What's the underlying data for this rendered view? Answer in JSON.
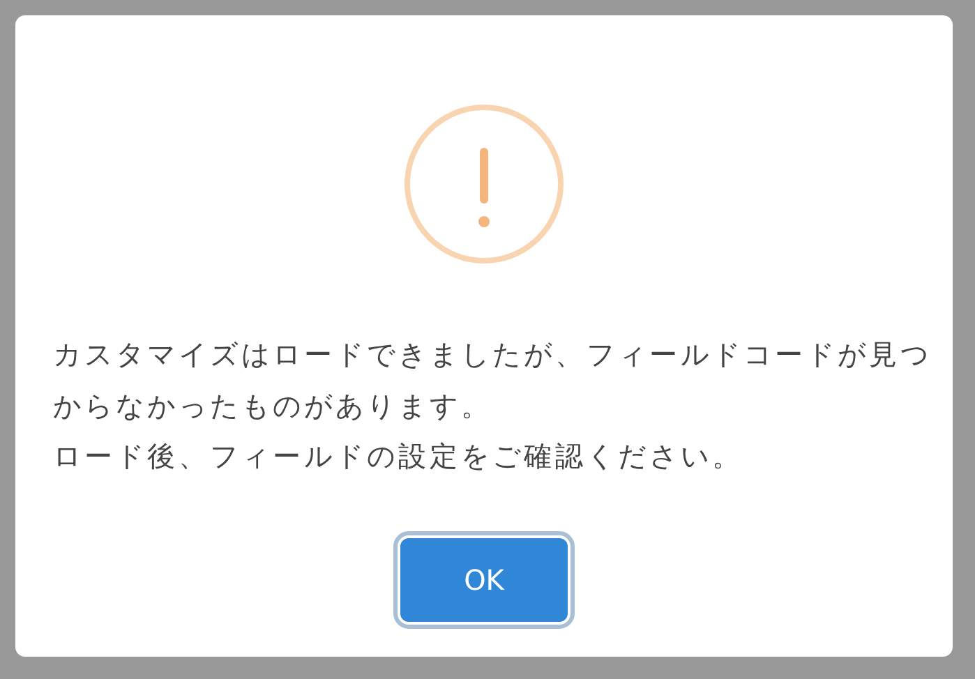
{
  "dialog": {
    "messages": [
      "カスタマイズはロードできましたが、フィールドコードが見つからなかったものがあります。",
      "ロード後、フィールドの設定をご確認ください。"
    ],
    "buttons": [
      {
        "label": "OK",
        "focused": true
      }
    ]
  }
}
